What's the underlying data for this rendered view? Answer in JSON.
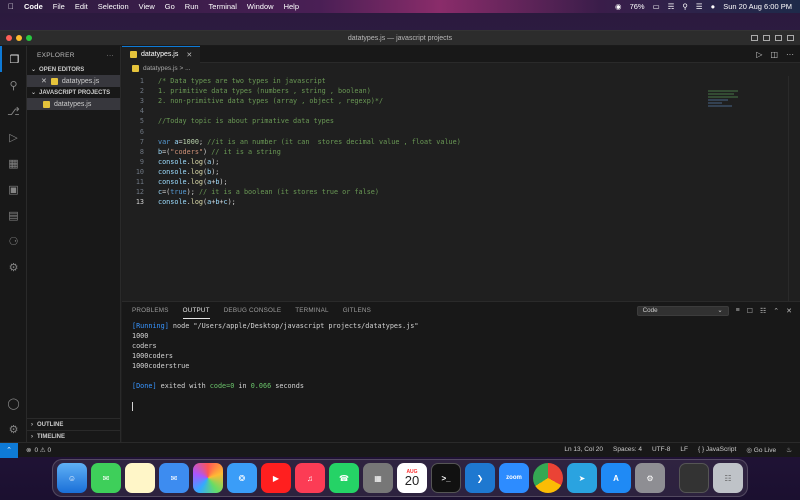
{
  "menubar": {
    "app": "Code",
    "items": [
      "File",
      "Edit",
      "Selection",
      "View",
      "Go",
      "Run",
      "Terminal",
      "Window",
      "Help"
    ],
    "battery": "76%",
    "datetime": "Sun 20 Aug  6:00 PM"
  },
  "window": {
    "title": "datatypes.js — javascript projects"
  },
  "sidebar": {
    "header": "EXPLORER",
    "open_editors": "OPEN EDITORS",
    "open_file": "datatypes.js",
    "project": "JAVASCRIPT PROJECTS",
    "project_file": "datatypes.js",
    "outline": "OUTLINE",
    "timeline": "TIMELINE"
  },
  "editor": {
    "tab": "datatypes.js",
    "breadcrumb": "datatypes.js > ...",
    "lines": [
      {
        "n": "1",
        "segs": [
          [
            "cm",
            "/* Data types are two types in javascript"
          ]
        ]
      },
      {
        "n": "2",
        "segs": [
          [
            "cm",
            "1. primitive data types (numbers , string , boolean)"
          ]
        ]
      },
      {
        "n": "3",
        "segs": [
          [
            "cm",
            "2. non-primitive data types (array , object , regexp)*/"
          ]
        ]
      },
      {
        "n": "4",
        "segs": []
      },
      {
        "n": "5",
        "segs": [
          [
            "cm",
            "//Today topic is about primative data types"
          ]
        ]
      },
      {
        "n": "6",
        "segs": []
      },
      {
        "n": "7",
        "segs": [
          [
            "kw",
            "var "
          ],
          [
            "var",
            "a"
          ],
          [
            "pl",
            "="
          ],
          [
            "num",
            "1000"
          ],
          [
            "pl",
            "; "
          ],
          [
            "cm",
            "//it is an number (it can  stores decimal value , float value)"
          ]
        ]
      },
      {
        "n": "8",
        "segs": [
          [
            "var",
            "b"
          ],
          [
            "pl",
            "=("
          ],
          [
            "str",
            "\"coders\""
          ],
          [
            "pl",
            ") "
          ],
          [
            "cm",
            "// it is a string"
          ]
        ]
      },
      {
        "n": "9",
        "segs": [
          [
            "var",
            "console"
          ],
          [
            "pl",
            "."
          ],
          [
            "fn",
            "log"
          ],
          [
            "pl",
            "("
          ],
          [
            "var",
            "a"
          ],
          [
            "pl",
            ");"
          ]
        ]
      },
      {
        "n": "10",
        "segs": [
          [
            "var",
            "console"
          ],
          [
            "pl",
            "."
          ],
          [
            "fn",
            "log"
          ],
          [
            "pl",
            "("
          ],
          [
            "var",
            "b"
          ],
          [
            "pl",
            ");"
          ]
        ]
      },
      {
        "n": "11",
        "segs": [
          [
            "var",
            "console"
          ],
          [
            "pl",
            "."
          ],
          [
            "fn",
            "log"
          ],
          [
            "pl",
            "("
          ],
          [
            "var",
            "a"
          ],
          [
            "pl",
            "+"
          ],
          [
            "var",
            "b"
          ],
          [
            "pl",
            ");"
          ]
        ]
      },
      {
        "n": "12",
        "segs": [
          [
            "var",
            "c"
          ],
          [
            "pl",
            "=("
          ],
          [
            "kw",
            "true"
          ],
          [
            "pl",
            "); "
          ],
          [
            "cm",
            "// it is a boolean (it stores true or false)"
          ]
        ]
      },
      {
        "n": "13",
        "segs": [
          [
            "var",
            "console"
          ],
          [
            "pl",
            "."
          ],
          [
            "fn",
            "log"
          ],
          [
            "pl",
            "("
          ],
          [
            "var",
            "a"
          ],
          [
            "pl",
            "+"
          ],
          [
            "var",
            "b"
          ],
          [
            "pl",
            "+"
          ],
          [
            "var",
            "c"
          ],
          [
            "pl",
            ");"
          ]
        ]
      }
    ]
  },
  "panel": {
    "tabs": [
      "PROBLEMS",
      "OUTPUT",
      "DEBUG CONSOLE",
      "TERMINAL",
      "GITLENS"
    ],
    "active_tab": "OUTPUT",
    "channel": "Code",
    "output": {
      "running_tag": "[Running]",
      "running_cmd": " node \"/Users/apple/Desktop/javascript projects/datatypes.js\"",
      "lines": [
        "1000",
        "coders",
        "1000coders",
        "1000coderstrue"
      ],
      "done_tag": "[Done]",
      "done_text": " exited with ",
      "done_code": "code=0",
      "done_in": " in ",
      "done_time": "0.066",
      "done_unit": " seconds"
    }
  },
  "status": {
    "problems": "0 ⚠ 0",
    "position": "Ln 13, Col 20",
    "spaces": "Spaces: 4",
    "encoding": "UTF-8",
    "eol": "LF",
    "language": "{ } JavaScript",
    "golive": "Go Live"
  },
  "dock": {
    "calendar_month": "AUG",
    "calendar_day": "20",
    "zoom_label": "zoom"
  },
  "colors": {
    "accent": "#0e7ad6",
    "editor_bg": "#1f1f1f",
    "comment": "#6a9955",
    "keyword": "#569cd6"
  }
}
